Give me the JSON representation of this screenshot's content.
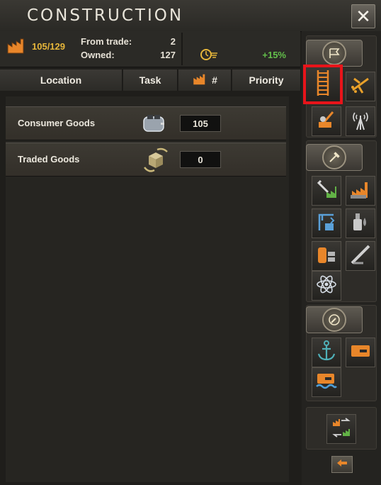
{
  "window": {
    "title": "CONSTRUCTION",
    "close_icon": "close-x-icon"
  },
  "stats": {
    "factories": "105/129",
    "from_trade_label": "From trade:",
    "from_trade_value": "2",
    "owned_label": "Owned:",
    "owned_value": "127",
    "speed_bonus": "+15%",
    "colors": {
      "factories": "#e6b63a",
      "bonus": "#63c04b"
    }
  },
  "columns": {
    "location": "Location",
    "task": "Task",
    "count_symbol": "#",
    "priority": "Priority"
  },
  "rows": [
    {
      "label": "Consumer Goods",
      "value": "105",
      "icon": "toaster-icon"
    },
    {
      "label": "Traded Goods",
      "value": "0",
      "icon": "trade-crate-icon"
    }
  ],
  "sidebar": {
    "groups": [
      {
        "name": "infrastructure",
        "icons": [
          "railway-icon",
          "airbase-icon",
          "anti-air-icon",
          "radar-icon"
        ]
      },
      {
        "name": "industry",
        "icons": [
          "civilian-factory-icon",
          "military-factory-icon",
          "infrastructure-icon",
          "synthetic-refinery-icon",
          "fuel-silo-icon",
          "rocket-site-icon",
          "nuclear-reactor-icon"
        ]
      },
      {
        "name": "naval",
        "icons": [
          "naval-base-icon",
          "bunker-icon",
          "coastal-fort-icon"
        ]
      },
      {
        "name": "conversion",
        "icons": [
          "factory-conversion-icon"
        ]
      }
    ],
    "highlight_color": "#e8141a"
  }
}
